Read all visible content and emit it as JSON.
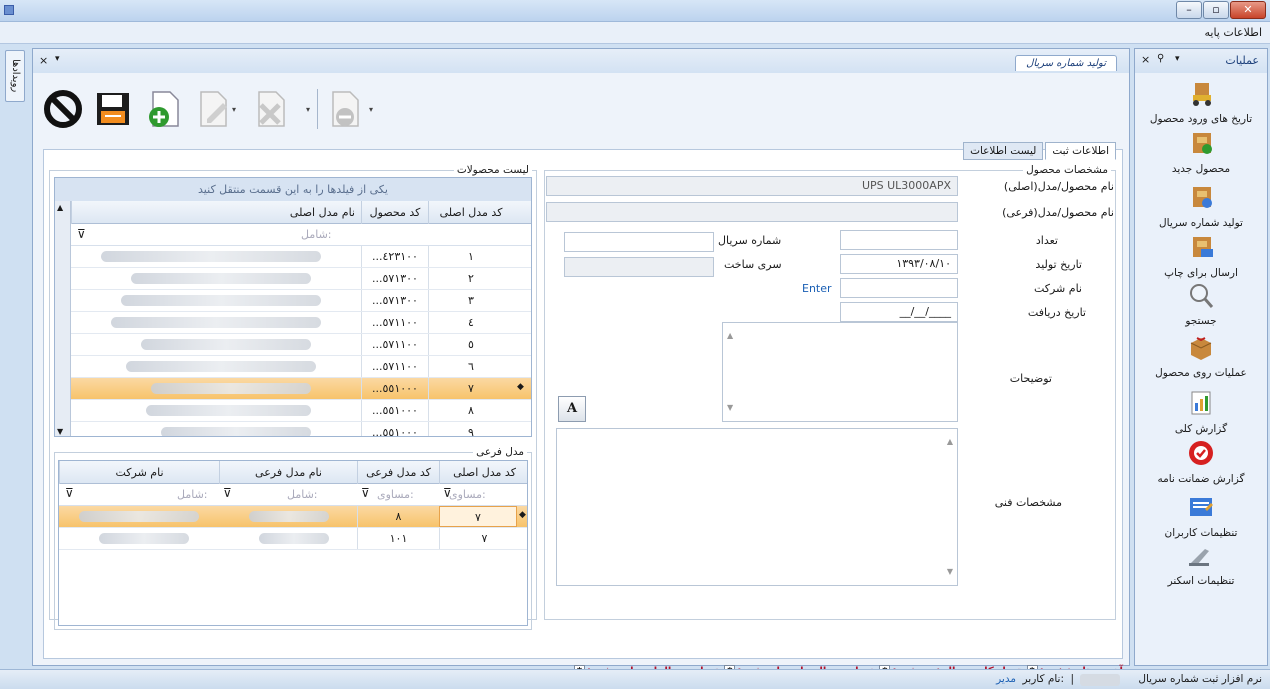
{
  "window": {
    "minimize": "–",
    "maximize": "▫",
    "close": "✕"
  },
  "menu": {
    "base_info": "اطلاعات پایه"
  },
  "left_tab": {
    "label": "رویدادها"
  },
  "doc": {
    "tab": "تولید شماره سریال",
    "close": "×",
    "dropdown": "▾"
  },
  "form_tabs": [
    {
      "label": "اطلاعات ثبت"
    },
    {
      "label": "لیست اطلاعات"
    }
  ],
  "products_group": {
    "title": "لیست محصولات",
    "group_hint": "یکی از فیلدها را به این قسمت منتقل کنید",
    "columns": [
      "کد مدل اصلی",
      "کد محصول",
      "نام مدل اصلی"
    ],
    "filter": "شامل:",
    "rows": [
      {
        "code": "١",
        "product": "...٤٢٣١٠٠"
      },
      {
        "code": "٢",
        "product": "...٥٧١٣٠٠"
      },
      {
        "code": "٣",
        "product": "...٥٧١٣٠٠"
      },
      {
        "code": "٤",
        "product": "...٥٧١١٠٠"
      },
      {
        "code": "٥",
        "product": "...٥٧١١٠٠"
      },
      {
        "code": "٦",
        "product": "...٥٧١١٠٠"
      },
      {
        "code": "٧",
        "product": "...٥٥١٠٠٠"
      },
      {
        "code": "٨",
        "product": "...٥٥١٠٠٠"
      },
      {
        "code": "٩",
        "product": "...٥٥١٠٠٠"
      }
    ]
  },
  "sub_group": {
    "title": "مدل فرعی",
    "columns": [
      "کد مدل اصلی",
      "کد مدل فرعی",
      "نام مدل فرعی",
      "نام شرکت"
    ],
    "filters": [
      "مساوی:",
      "مساوی:",
      "شامل:",
      "شامل:"
    ],
    "rows": [
      {
        "main": "٧",
        "sub": "٨"
      },
      {
        "main": "٧",
        "sub": "١٠١"
      }
    ]
  },
  "spec_group": {
    "title": "مشخصات محصول",
    "main_model_label": "نام محصول/مدل(اصلی)",
    "main_model_value": "UPS UL3000APX",
    "sub_model_label": "نام محصول/مدل(فرعی)",
    "count_label": "تعداد",
    "serial_label": "شماره سریال",
    "prod_date_label": "تاریخ تولید",
    "prod_date_value": "١٣٩٣/٠٨/١٠",
    "series_label": "سری ساخت",
    "company_label": "نام شرکت",
    "enter_label": "Enter",
    "receive_label": "تاریخ دریافت",
    "receive_value": "__/__/____",
    "desc_label": "توضیحات",
    "tech_label": "مشخصات فنی",
    "font_btn": "A"
  },
  "summary": {
    "last_date": "آخرین تاریخ ثبت:",
    "total": "تعداد کل سریال ثبت شده:",
    "printed": "تعداد سریال های چاپ شده:",
    "unprinted": "تعداد سریالهای چاپ نشده:",
    "box": "*"
  },
  "right_panel": {
    "title": "عملیات",
    "items": [
      {
        "label": "تاریخ های ورود محصول"
      },
      {
        "label": "محصول جدید"
      },
      {
        "label": "تولید شماره سریال"
      },
      {
        "label": "ارسال برای چاپ"
      },
      {
        "label": "جستجو"
      },
      {
        "label": "عملیات روی محصول"
      },
      {
        "label": "گزارش کلی"
      },
      {
        "label": "گزارش ضمانت نامه"
      },
      {
        "label": "تنظیمات کاربران"
      },
      {
        "label": "تنظیمات اسکنر"
      }
    ]
  },
  "status": {
    "app": "نرم افزار ثبت شماره سریال",
    "user_label": "نام کاربر:",
    "user": "مدیر"
  },
  "colors": {
    "selection": "#f7c36b",
    "summary_red": "#b0112b",
    "link_blue": "#1a5fb4"
  }
}
